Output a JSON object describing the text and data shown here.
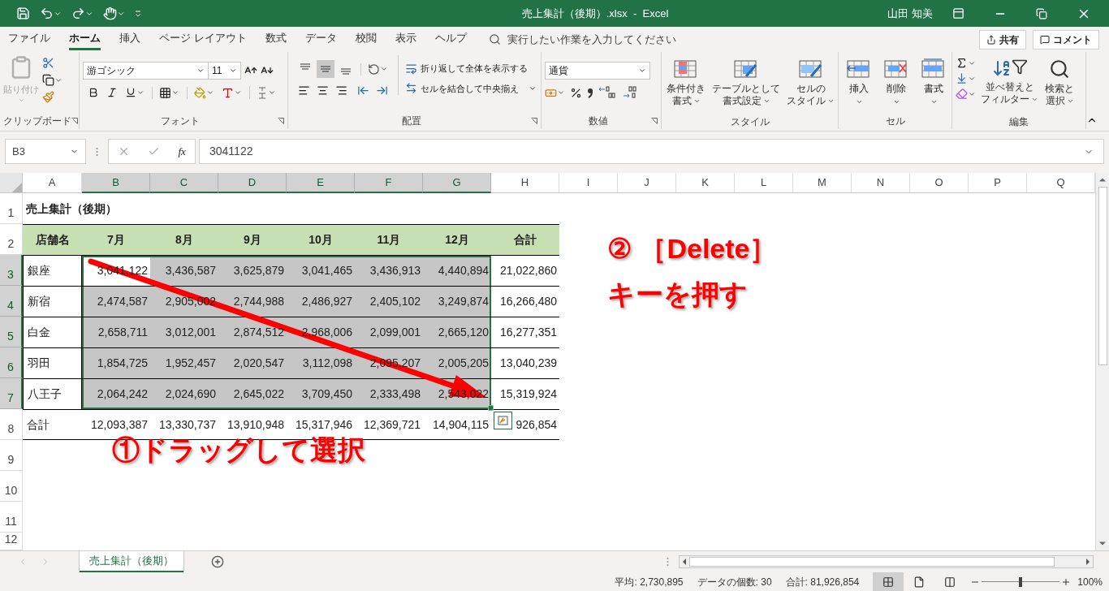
{
  "title_bar": {
    "title": "売上集計（後期）.xlsx  -  Excel",
    "user": "山田 知美"
  },
  "menu": {
    "tabs": [
      {
        "label": "ファイル",
        "selected": false
      },
      {
        "label": "ホーム",
        "selected": true
      },
      {
        "label": "挿入",
        "selected": false
      },
      {
        "label": "ページ レイアウト",
        "selected": false
      },
      {
        "label": "数式",
        "selected": false
      },
      {
        "label": "データ",
        "selected": false
      },
      {
        "label": "校閲",
        "selected": false
      },
      {
        "label": "表示",
        "selected": false
      },
      {
        "label": "ヘルプ",
        "selected": false
      }
    ],
    "search": {
      "placeholder": "実行したい作業を入力してください"
    },
    "share": "共有",
    "comment": "コメント"
  },
  "ribbon": {
    "clipboard": {
      "paste": "貼り付け",
      "paste_disabled": true,
      "label": "クリップボード"
    },
    "font": {
      "font_name": "游ゴシック",
      "font_size": "11",
      "label": "フォント"
    },
    "alignment": {
      "vertical": [
        {
          "selected": false
        },
        {
          "selected": true
        },
        {
          "selected": false
        }
      ],
      "wrap": "折り返して全体を表示する",
      "merge": "セルを結合して中央揃え",
      "label": "配置"
    },
    "number": {
      "format": "通貨",
      "label": "数値"
    },
    "styles": {
      "buttons": [
        {
          "line1": "条件付き",
          "line2": "書式"
        },
        {
          "line1": "テーブルとして",
          "line2": "書式設定"
        },
        {
          "line1": "セルの",
          "line2": "スタイル"
        }
      ],
      "label": "スタイル"
    },
    "cells": {
      "buttons": [
        "挿入",
        "削除",
        "書式"
      ],
      "label": "セル"
    },
    "editing": {
      "buttons": [
        {
          "line1": "並べ替えと",
          "line2": "フィルター"
        },
        {
          "line1": "検索と",
          "line2": "選択"
        }
      ],
      "label": "編集"
    }
  },
  "formula_bar": {
    "name_box": "B3",
    "fx": "fx",
    "value": "3041122"
  },
  "sheet": {
    "columns": [
      {
        "label": "A",
        "selected": false
      },
      {
        "label": "B",
        "selected": true
      },
      {
        "label": "C",
        "selected": true
      },
      {
        "label": "D",
        "selected": true
      },
      {
        "label": "E",
        "selected": true
      },
      {
        "label": "F",
        "selected": true
      },
      {
        "label": "G",
        "selected": true
      },
      {
        "label": "H",
        "selected": false
      },
      {
        "label": "I",
        "selected": false
      },
      {
        "label": "J",
        "selected": false
      },
      {
        "label": "K",
        "selected": false
      },
      {
        "label": "L",
        "selected": false
      },
      {
        "label": "M",
        "selected": false
      },
      {
        "label": "N",
        "selected": false
      },
      {
        "label": "O",
        "selected": false
      },
      {
        "label": "P",
        "selected": false
      },
      {
        "label": "Q",
        "selected": false
      }
    ],
    "rows": [
      {
        "header": "1",
        "kind": "title",
        "selected": false,
        "cells": [
          {
            "text": "売上集計（後期）",
            "selected": false,
            "active": false
          }
        ]
      },
      {
        "header": "2",
        "kind": "header",
        "selected": false,
        "cells": [
          {
            "text": "店舗名",
            "selected": false,
            "active": false
          },
          {
            "text": "7月",
            "selected": false,
            "active": false
          },
          {
            "text": "8月",
            "selected": false,
            "active": false
          },
          {
            "text": "9月",
            "selected": false,
            "active": false
          },
          {
            "text": "10月",
            "selected": false,
            "active": false
          },
          {
            "text": "11月",
            "selected": false,
            "active": false
          },
          {
            "text": "12月",
            "selected": false,
            "active": false
          },
          {
            "text": "合計",
            "selected": false,
            "active": false
          }
        ]
      },
      {
        "header": "3",
        "kind": "data",
        "selected": true,
        "cells": [
          {
            "text": "銀座",
            "selected": false,
            "active": false
          },
          {
            "text": "3,041,122",
            "selected": true,
            "active": true
          },
          {
            "text": "3,436,587",
            "selected": true,
            "active": false
          },
          {
            "text": "3,625,879",
            "selected": true,
            "active": false
          },
          {
            "text": "3,041,465",
            "selected": true,
            "active": false
          },
          {
            "text": "3,436,913",
            "selected": true,
            "active": false
          },
          {
            "text": "4,440,894",
            "selected": true,
            "active": false
          },
          {
            "text": "21,022,860",
            "selected": false,
            "active": false
          }
        ]
      },
      {
        "header": "4",
        "kind": "data",
        "selected": true,
        "cells": [
          {
            "text": "新宿",
            "selected": false,
            "active": false
          },
          {
            "text": "2,474,587",
            "selected": true,
            "active": false
          },
          {
            "text": "2,905,002",
            "selected": true,
            "active": false
          },
          {
            "text": "2,744,988",
            "selected": true,
            "active": false
          },
          {
            "text": "2,486,927",
            "selected": true,
            "active": false
          },
          {
            "text": "2,405,102",
            "selected": true,
            "active": false
          },
          {
            "text": "3,249,874",
            "selected": true,
            "active": false
          },
          {
            "text": "16,266,480",
            "selected": false,
            "active": false
          }
        ]
      },
      {
        "header": "5",
        "kind": "data",
        "selected": true,
        "cells": [
          {
            "text": "白金",
            "selected": false,
            "active": false
          },
          {
            "text": "2,658,711",
            "selected": true,
            "active": false
          },
          {
            "text": "3,012,001",
            "selected": true,
            "active": false
          },
          {
            "text": "2,874,512",
            "selected": true,
            "active": false
          },
          {
            "text": "2,968,006",
            "selected": true,
            "active": false
          },
          {
            "text": "2,099,001",
            "selected": true,
            "active": false
          },
          {
            "text": "2,665,120",
            "selected": true,
            "active": false
          },
          {
            "text": "16,277,351",
            "selected": false,
            "active": false
          }
        ]
      },
      {
        "header": "6",
        "kind": "data",
        "selected": true,
        "cells": [
          {
            "text": "羽田",
            "selected": false,
            "active": false
          },
          {
            "text": "1,854,725",
            "selected": true,
            "active": false
          },
          {
            "text": "1,952,457",
            "selected": true,
            "active": false
          },
          {
            "text": "2,020,547",
            "selected": true,
            "active": false
          },
          {
            "text": "3,112,098",
            "selected": true,
            "active": false
          },
          {
            "text": "2,095,207",
            "selected": true,
            "active": false
          },
          {
            "text": "2,005,205",
            "selected": true,
            "active": false
          },
          {
            "text": "13,040,239",
            "selected": false,
            "active": false
          }
        ]
      },
      {
        "header": "7",
        "kind": "data",
        "selected": true,
        "cells": [
          {
            "text": "八王子",
            "selected": false,
            "active": false
          },
          {
            "text": "2,064,242",
            "selected": true,
            "active": false
          },
          {
            "text": "2,024,690",
            "selected": true,
            "active": false
          },
          {
            "text": "2,645,022",
            "selected": true,
            "active": false
          },
          {
            "text": "3,709,450",
            "selected": true,
            "active": false
          },
          {
            "text": "2,333,498",
            "selected": true,
            "active": false
          },
          {
            "text": "2,543,022",
            "selected": true,
            "active": false
          },
          {
            "text": "15,319,924",
            "selected": false,
            "active": false
          }
        ]
      },
      {
        "header": "8",
        "kind": "total",
        "selected": false,
        "cells": [
          {
            "text": "合計",
            "selected": false,
            "active": false
          },
          {
            "text": "12,093,387",
            "selected": false,
            "active": false
          },
          {
            "text": "13,330,737",
            "selected": false,
            "active": false
          },
          {
            "text": "13,910,948",
            "selected": false,
            "active": false
          },
          {
            "text": "15,317,946",
            "selected": false,
            "active": false
          },
          {
            "text": "12,369,721",
            "selected": false,
            "active": false
          },
          {
            "text": "14,904,115",
            "selected": false,
            "active": false
          },
          {
            "text": "926,854",
            "selected": false,
            "active": false
          }
        ]
      },
      {
        "header": "9",
        "kind": "empty",
        "selected": false
      },
      {
        "header": "10",
        "kind": "empty",
        "selected": false
      },
      {
        "header": "11",
        "kind": "empty",
        "selected": false
      },
      {
        "header": "12",
        "kind": "empty",
        "selected": false
      }
    ]
  },
  "annotations": [
    {
      "kind": "step",
      "text": "② ［Delete］"
    },
    {
      "kind": "step",
      "text": "キーを押す"
    },
    {
      "kind": "step",
      "text": "①ドラッグして選択"
    }
  ],
  "sheet_tabs": [
    {
      "label": "売上集計（後期）",
      "selected": true
    }
  ],
  "status_bar": {
    "average": "平均: 2,730,895",
    "count": "データの個数: 30",
    "sum": "合計: 81,926,854",
    "views": [
      {
        "selected": true
      },
      {
        "selected": false
      },
      {
        "selected": false
      }
    ],
    "zoom": {
      "level": 0.5
    },
    "zoom_text": "100%"
  }
}
